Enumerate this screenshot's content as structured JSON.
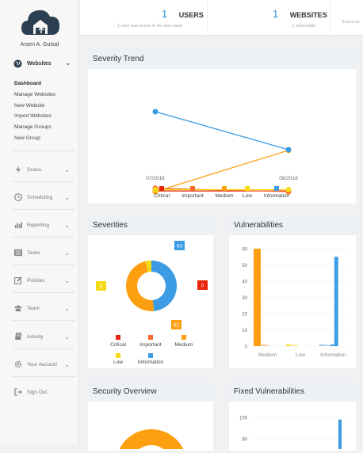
{
  "user": {
    "name": "Arsen A. Gutsal"
  },
  "nav": {
    "websites": "Websites",
    "sub": [
      "Dashboard",
      "Manage Websites",
      "New Website",
      "Import Websites",
      "Manage Groups",
      "New Group"
    ],
    "items": [
      "Scans",
      "Scheduling",
      "Reporting",
      "Tasks",
      "Policies",
      "Team",
      "Activity",
      "Your Account",
      "Sign Out"
    ]
  },
  "top": {
    "users_count": "1",
    "users_label": "USERS",
    "users_sub": "1 user was active in the last week",
    "websites_count": "1",
    "websites_label": "WEBSITES",
    "websites_sub": "1 vulnerable",
    "scans_sub": "Scans co"
  },
  "cards": {
    "severity_trend": "Severity Trend",
    "severities": "Severities",
    "vulnerabilities": "Vulnerabilities",
    "security_overview": "Security Overview",
    "fixed_vulnerabilities": "Fixed Vulnerabilities"
  },
  "colors": {
    "critical": "#e8250c",
    "important": "#fb6a2a",
    "medium": "#fd9f10",
    "low": "#f5da15",
    "information": "#3b9be3",
    "accent": "#2a92d8"
  },
  "chart_data": [
    {
      "type": "line",
      "x": [
        "07/2016",
        "08/2016"
      ],
      "series": [
        {
          "name": "Critical",
          "values": [
            1,
            1
          ]
        },
        {
          "name": "Important",
          "values": [
            5,
            0
          ]
        },
        {
          "name": "Medium",
          "values": [
            0,
            62
          ]
        },
        {
          "name": "Low",
          "values": [
            3,
            3
          ]
        },
        {
          "name": "Information",
          "values": [
            120,
            63
          ]
        }
      ],
      "legend": "bottom"
    },
    {
      "type": "pie",
      "labels": [
        "Critical",
        "Important",
        "Medium",
        "Low",
        "Information"
      ],
      "values": [
        0,
        0,
        62,
        5,
        63
      ],
      "label_values": [
        "0",
        "62",
        "5",
        "63"
      ],
      "legend": "bottom"
    },
    {
      "type": "bar",
      "categories": [
        "Medium",
        "Low",
        "Information"
      ],
      "ylim": [
        0,
        60
      ],
      "yticks": [
        "0",
        "10",
        "20",
        "30",
        "40",
        "50",
        "60"
      ],
      "series": [
        {
          "values": [
            60,
            1,
            1
          ]
        },
        {
          "values": [
            1,
            1,
            1
          ]
        },
        {
          "values": [
            1,
            1,
            1
          ]
        },
        {
          "values": [
            0,
            0,
            1
          ]
        },
        {
          "values": [
            0,
            0,
            55
          ]
        }
      ]
    },
    {
      "type": "bar",
      "yticks": [
        "80",
        "100"
      ],
      "series": [
        {
          "values": [
            98
          ]
        }
      ]
    }
  ]
}
